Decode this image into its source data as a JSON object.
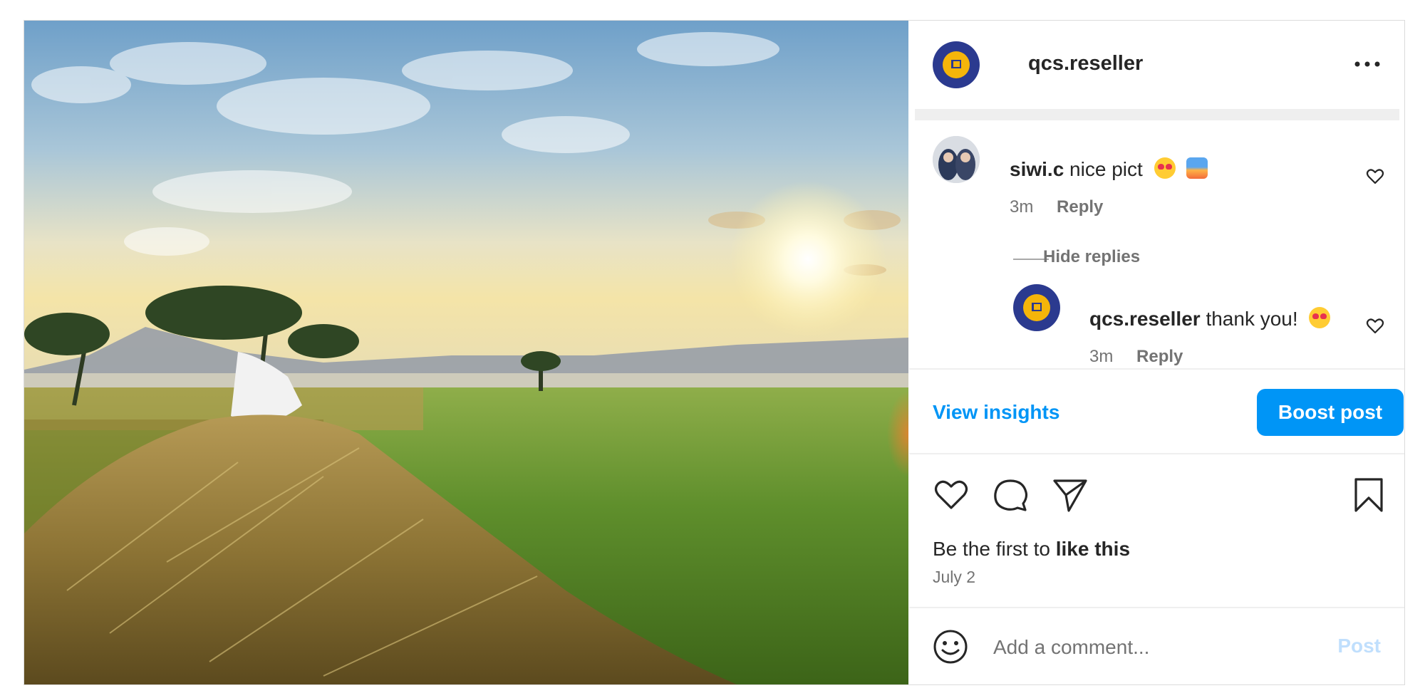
{
  "post": {
    "author": "qcs.reseller",
    "more_icon": "more-horizontal-icon",
    "image_alt": "rice field at sunrise with straw pile and scarecrow"
  },
  "comments": [
    {
      "username": "siwi.c",
      "text": "nice pict",
      "emojis": [
        "heart-eyes-emoji",
        "sunrise-emoji"
      ],
      "time": "3m",
      "reply_label": "Reply",
      "hide_replies_label": "Hide replies",
      "replies": [
        {
          "username": "qcs.reseller",
          "text": "thank you!",
          "emojis": [
            "heart-eyes-emoji"
          ],
          "time": "3m",
          "reply_label": "Reply"
        }
      ]
    }
  ],
  "insights": {
    "view_label": "View insights",
    "boost_label": "Boost post"
  },
  "actions": {
    "icons": [
      "heart-icon",
      "comment-icon",
      "share-icon",
      "bookmark-icon"
    ]
  },
  "likes": {
    "prefix": "Be the first to",
    "link": "like this"
  },
  "date": "July 2",
  "add_comment": {
    "placeholder": "Add a comment...",
    "post_label": "Post"
  },
  "colors": {
    "accent": "#0095f6",
    "post_disabled": "#c0dffd",
    "brand_navy": "#2b3a8f",
    "brand_yellow": "#f5b50a"
  }
}
